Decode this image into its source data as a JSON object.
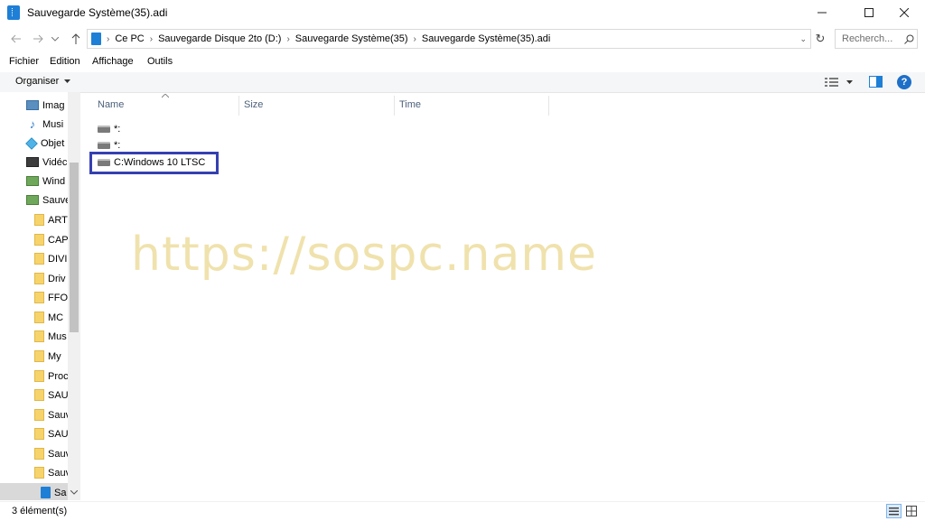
{
  "window": {
    "title": "Sauvegarde Système(35).adi"
  },
  "address": {
    "crumbs": [
      "Ce PC",
      "Sauvegarde Disque 2to (D:)",
      "Sauvegarde Système(35)",
      "Sauvegarde Système(35).adi"
    ],
    "search_placeholder": "Recherch..."
  },
  "menu": {
    "items": [
      "Fichier",
      "Edition",
      "Affichage",
      "Outils"
    ]
  },
  "toolbar": {
    "organize_label": "Organiser"
  },
  "columns": {
    "name": "Name",
    "size": "Size",
    "time": "Time"
  },
  "files": [
    "*:",
    "*:",
    "C:Windows 10 LTSC"
  ],
  "nav": {
    "items": [
      "Imag",
      "Musi",
      "Objet",
      "Vidéc",
      "Wind",
      "Sauve",
      "ART",
      "CAP",
      "DIVI",
      "Driv",
      "FFO",
      "MC",
      "Mus",
      "My",
      "Proc",
      "SAU",
      "Sauv",
      "SAU",
      "Sauv",
      "Sauv",
      "Sa"
    ]
  },
  "status": {
    "count": "3 élément(s)"
  },
  "watermark": "https://sospc.name",
  "colors": {
    "highlight": "#3540b0",
    "accent": "#1e7fd6"
  }
}
